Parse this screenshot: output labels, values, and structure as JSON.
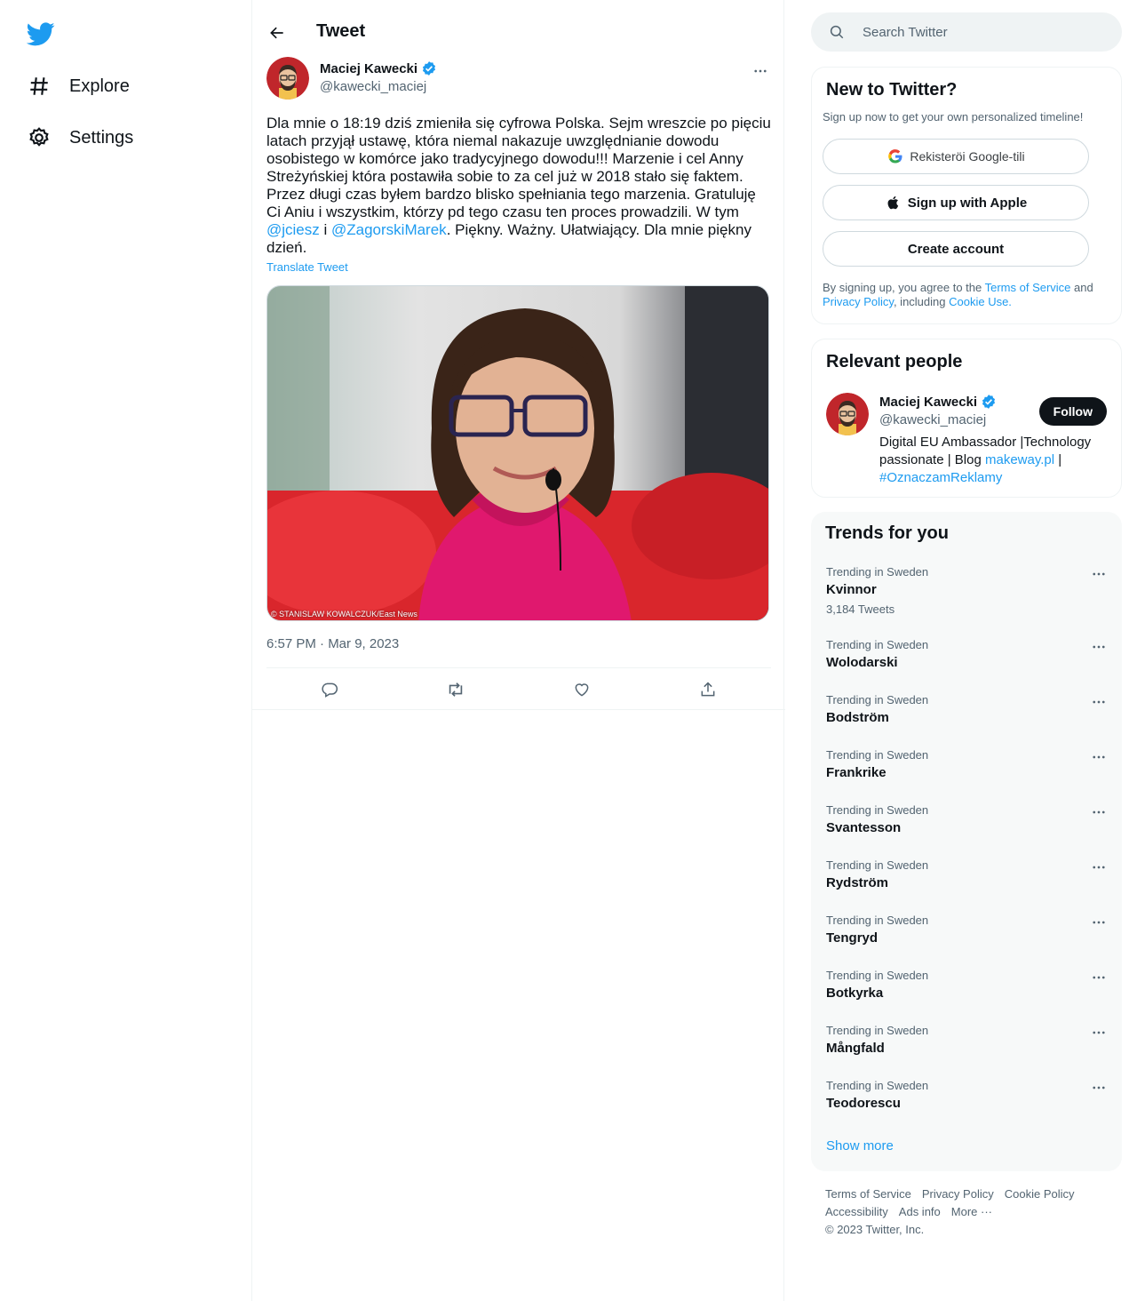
{
  "nav": {
    "items": [
      {
        "label": "Explore",
        "icon": "hashtag-icon"
      },
      {
        "label": "Settings",
        "icon": "gear-icon"
      }
    ]
  },
  "header": {
    "title": "Tweet"
  },
  "tweet": {
    "author_name": "Maciej Kawecki",
    "author_handle": "@kawecki_maciej",
    "text_part1": "Dla mnie o 18:19 dziś zmieniła się cyfrowa Polska. Sejm wreszcie po pięciu latach przyjął ustawę, która niemal nakazuje uwzględnianie dowodu osobistego w komórce jako tradycyjnego dowodu!!! Marzenie i cel Anny Streżyńskiej która postawiła sobie to za cel już w 2018 stało się faktem. Przez długi czas byłem bardzo blisko spełniania tego marzenia. Gratuluję Ci Aniu i wszystkim, którzy pd tego czasu ten proces prowadzili. W tym ",
    "mention1": "@jciesz",
    "text_part2": " i ",
    "mention2": "@ZagorskiMarek",
    "text_part3": ". Piękny. Ważny. Ułatwiający. Dla mnie piękny dzień.",
    "translate_label": "Translate Tweet",
    "media_credit": "© STANISLAW KOWALCZUK/East News",
    "timestamp": "6:57 PM · Mar 9, 2023"
  },
  "search": {
    "placeholder": "Search Twitter"
  },
  "signup": {
    "title": "New to Twitter?",
    "subtitle": "Sign up now to get your own personalized timeline!",
    "google_label": "Rekisteröi Google-tili",
    "apple_label": "Sign up with Apple",
    "create_label": "Create account",
    "legal_prefix": "By signing up, you agree to the ",
    "terms": "Terms of Service",
    "and": " and ",
    "privacy": "Privacy Policy",
    "including": ", including ",
    "cookie": "Cookie Use."
  },
  "people": {
    "title": "Relevant people",
    "name": "Maciej Kawecki",
    "handle": "@kawecki_maciej",
    "follow_label": "Follow",
    "bio_part1": "Digital EU Ambassador |Technology passionate | Blog ",
    "bio_link": "makeway.pl",
    "bio_part2": " | ",
    "bio_hashtag": "#OznaczamReklamy"
  },
  "trends": {
    "title": "Trends for you",
    "items": [
      {
        "context": "Trending in Sweden",
        "name": "Kvinnor",
        "count": "3,184 Tweets"
      },
      {
        "context": "Trending in Sweden",
        "name": "Wolodarski"
      },
      {
        "context": "Trending in Sweden",
        "name": "Bodström"
      },
      {
        "context": "Trending in Sweden",
        "name": "Frankrike"
      },
      {
        "context": "Trending in Sweden",
        "name": "Svantesson"
      },
      {
        "context": "Trending in Sweden",
        "name": "Rydström"
      },
      {
        "context": "Trending in Sweden",
        "name": "Tengryd"
      },
      {
        "context": "Trending in Sweden",
        "name": "Botkyrka"
      },
      {
        "context": "Trending in Sweden",
        "name": "Mångfald"
      },
      {
        "context": "Trending in Sweden",
        "name": "Teodorescu"
      }
    ],
    "show_more": "Show more"
  },
  "footer": {
    "links": [
      "Terms of Service",
      "Privacy Policy",
      "Cookie Policy",
      "Accessibility",
      "Ads info",
      "More ···"
    ],
    "copyright": "© 2023 Twitter, Inc."
  },
  "colors": {
    "accent": "#1d9bf0",
    "text": "#0f1419",
    "muted": "#536471",
    "border": "#eff3f4"
  }
}
